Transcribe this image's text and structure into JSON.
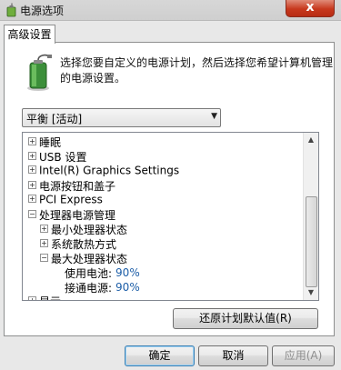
{
  "window": {
    "title": "电源选项",
    "close_label": "x"
  },
  "tab": {
    "label": "高级设置"
  },
  "description": "选择您要自定义的电源计划，然后选择您希望计算机管理的电源设置。",
  "plan_select": {
    "value": "平衡 [活动]"
  },
  "tree": {
    "items": [
      {
        "label": "睡眠",
        "expander": "+"
      },
      {
        "label": "USB 设置",
        "expander": "+"
      },
      {
        "label": "Intel(R) Graphics Settings",
        "expander": "+"
      },
      {
        "label": "电源按钮和盖子",
        "expander": "+"
      },
      {
        "label": "PCI Express",
        "expander": "+"
      },
      {
        "label": "处理器电源管理",
        "expander": "−"
      },
      {
        "label": "最小处理器状态",
        "expander": "+"
      },
      {
        "label": "系统散热方式",
        "expander": "+"
      },
      {
        "label": "最大处理器状态",
        "expander": "−"
      },
      {
        "label": "使用电池:",
        "value": "90%"
      },
      {
        "label": "接通电源:",
        "value": "90%"
      },
      {
        "label": "显示",
        "expander": "+"
      }
    ]
  },
  "buttons": {
    "restore": "还原计划默认值(R)",
    "ok": "确定",
    "cancel": "取消",
    "apply": "应用(A)"
  }
}
